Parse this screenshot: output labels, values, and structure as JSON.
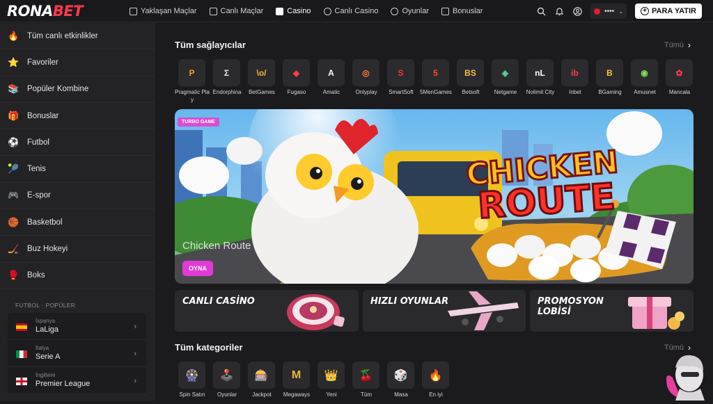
{
  "brand": {
    "logo_main": "RONA",
    "logo_accent": "BET"
  },
  "nav": [
    {
      "label": "Yaklaşan Maçlar",
      "icon": "calendar-icon"
    },
    {
      "label": "Canlı Maçlar",
      "icon": "live-tv-icon"
    },
    {
      "label": "Casino",
      "icon": "slot-seven-icon"
    },
    {
      "label": "Canlı Casino",
      "icon": "live-casino-icon"
    },
    {
      "label": "Oyunlar",
      "icon": "rocket-icon"
    },
    {
      "label": "Bonuslar",
      "icon": "gift-icon"
    }
  ],
  "header": {
    "language_value": "••••",
    "deposit_label": "PARA YATIR"
  },
  "sidebar": {
    "items": [
      {
        "label": "Tüm canlı etkinlikler",
        "icon": "🔥"
      },
      {
        "label": "Favoriler",
        "icon": "⭐"
      },
      {
        "label": "Popüler Kombine",
        "icon": "📚"
      },
      {
        "label": "Bonuslar",
        "icon": "🎁"
      },
      {
        "label": "Futbol",
        "icon": "⚽"
      },
      {
        "label": "Tenis",
        "icon": "🎾"
      },
      {
        "label": "E-spor",
        "icon": "🎮"
      },
      {
        "label": "Basketbol",
        "icon": "🏀"
      },
      {
        "label": "Buz Hokeyi",
        "icon": "🏒"
      },
      {
        "label": "Boks",
        "icon": "🥊"
      }
    ],
    "section_label": "FUTBOL · POPÜLER",
    "leagues": [
      {
        "country": "İspanya",
        "name": "LaLiga",
        "flag": "spain"
      },
      {
        "country": "İtalya",
        "name": "Serie A",
        "flag": "italy"
      },
      {
        "country": "İngiltere",
        "name": "Premier League",
        "flag": "england"
      }
    ]
  },
  "providers_section": {
    "title": "Tüm sağlayıcılar",
    "see_all": "Tümü"
  },
  "providers": [
    {
      "name": "Pragmatic Play",
      "mark": "P",
      "color": "#f19a2e"
    },
    {
      "name": "Endorphina",
      "mark": "Σ",
      "color": "#e8e8ea"
    },
    {
      "name": "BetGames",
      "mark": "\\o/",
      "color": "#f2b737"
    },
    {
      "name": "Fugaso",
      "mark": "◆",
      "color": "#ff3a4c"
    },
    {
      "name": "Amatic",
      "mark": "A",
      "color": "#ffffff"
    },
    {
      "name": "Onlyplay",
      "mark": "◎",
      "color": "#ff7a3c"
    },
    {
      "name": "SmartSoft",
      "mark": "S",
      "color": "#ff2f3e"
    },
    {
      "name": "5MenGames",
      "mark": "5",
      "color": "#ff4b2b"
    },
    {
      "name": "Betsoft",
      "mark": "BS",
      "color": "#f4c33e"
    },
    {
      "name": "Netgame",
      "mark": "◈",
      "color": "#56d39a"
    },
    {
      "name": "Nolimit City",
      "mark": "nL",
      "color": "#ffffff"
    },
    {
      "name": "Inbet",
      "mark": "ib",
      "color": "#ff3a4c"
    },
    {
      "name": "BGaming",
      "mark": "B",
      "color": "#f5c542"
    },
    {
      "name": "Amusnet",
      "mark": "◉",
      "color": "#7ed957"
    },
    {
      "name": "Mancala",
      "mark": "✿",
      "color": "#ff3a4c"
    }
  ],
  "hero": {
    "badge": "TURBO GAME",
    "title_line1": "CHICKEN",
    "title_line2": "ROUTE",
    "game_name": "Chicken Route",
    "cta": "OYNA"
  },
  "promos": [
    {
      "line1": "CANLI CASİNO",
      "line2": ""
    },
    {
      "line1": "HIZLI OYUNLAR",
      "line2": ""
    },
    {
      "line1": "PROMOSYON",
      "line2": "LOBİSİ"
    }
  ],
  "categories_section": {
    "title": "Tüm kategoriler",
    "see_all": "Tümü"
  },
  "categories": [
    {
      "name": "Spin Satın",
      "icon": "🎡"
    },
    {
      "name": "Oyunlar",
      "icon": "🕹️"
    },
    {
      "name": "Jackpot",
      "icon": "🎰"
    },
    {
      "name": "Megaways",
      "icon": "M"
    },
    {
      "name": "Yeni",
      "icon": "👑"
    },
    {
      "name": "Tüm",
      "icon": "🍒"
    },
    {
      "name": "Masa",
      "icon": "🎲"
    },
    {
      "name": "En iyi",
      "icon": "🔥"
    }
  ]
}
